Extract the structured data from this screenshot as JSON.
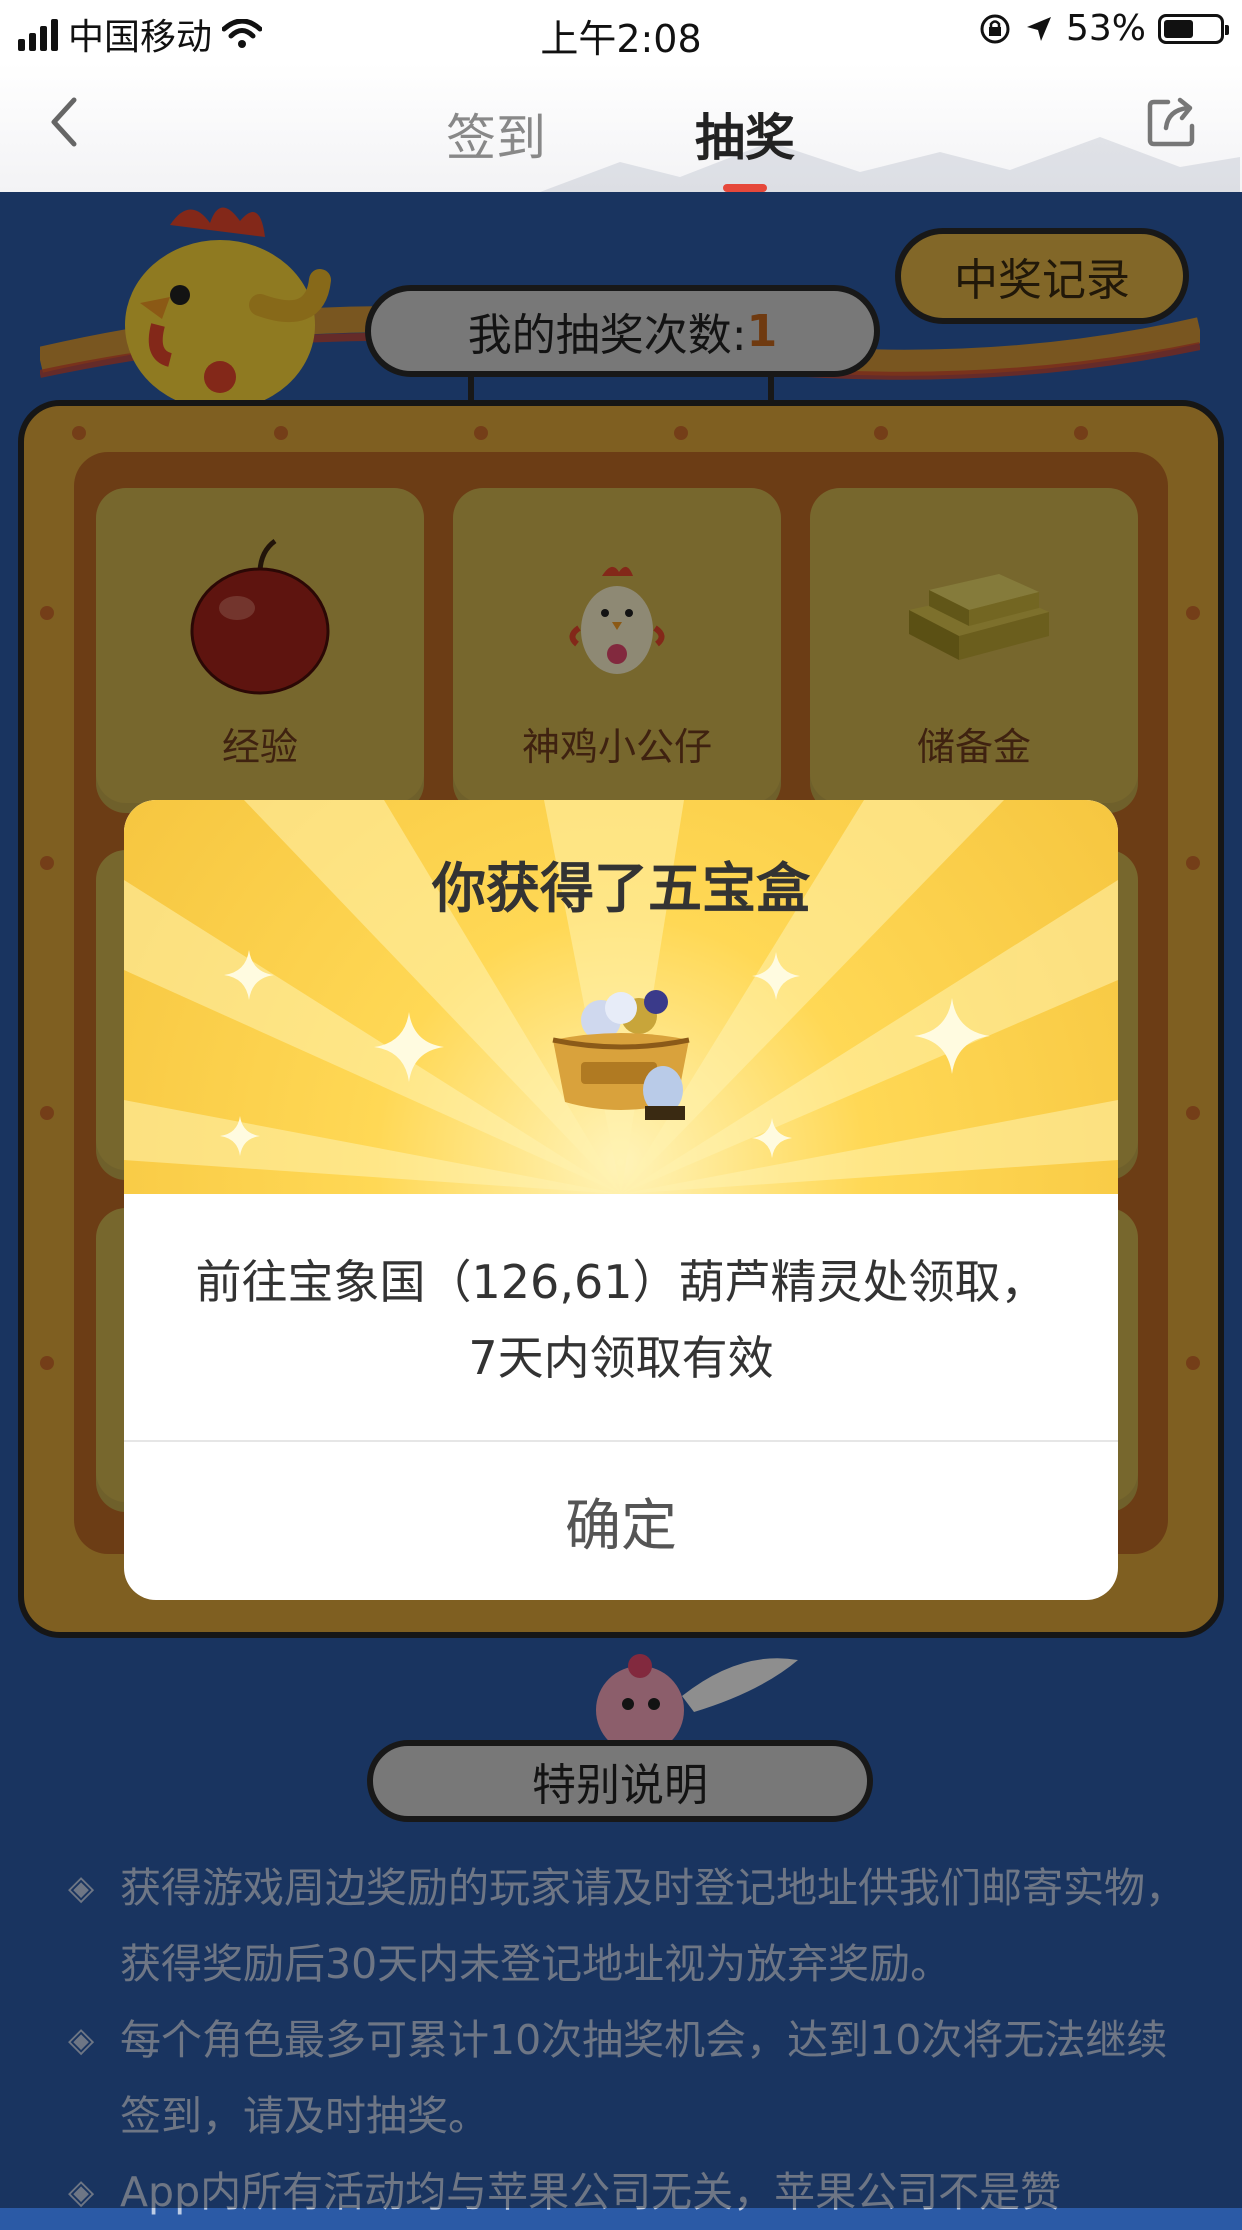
{
  "status_bar": {
    "carrier": "中国移动",
    "time": "上午2:08",
    "battery_percent": "53%",
    "battery_level": 0.53,
    "icons": [
      "signal-icon",
      "wifi-icon",
      "orientation-lock-icon",
      "location-arrow-icon",
      "battery-icon"
    ]
  },
  "nav": {
    "tabs": [
      {
        "label": "签到",
        "active": false
      },
      {
        "label": "抽奖",
        "active": true
      }
    ],
    "icons": [
      "back-chevron-icon",
      "share-icon"
    ],
    "accent_color": "#e6483b"
  },
  "lottery": {
    "record_button": "中奖记录",
    "count_label": "我的抽奖次数:",
    "count_value": "1",
    "prizes": [
      {
        "label": "经验",
        "icon": "apple-icon"
      },
      {
        "label": "神鸡小公仔",
        "icon": "chicken-doll-icon"
      },
      {
        "label": "储备金",
        "icon": "gold-bars-icon"
      }
    ]
  },
  "special": {
    "title": "特别说明",
    "bullet": "◈",
    "notes": [
      "获得游戏周边奖励的玩家请及时登记地址供我们邮寄实物，获得奖励后30天内未登记地址视为放弃奖励。",
      "每个角色最多可累计10次抽奖机会，达到10次将无法继续签到，请及时抽奖。",
      "App内所有活动均与苹果公司无关，苹果公司不是赞"
    ]
  },
  "modal": {
    "title": "你获得了五宝盒",
    "icon": "treasure-pot-icon",
    "message": "前往宝象国（126,61）葫芦精灵处领取，7天内领取有效",
    "confirm": "确定"
  },
  "colors": {
    "page_background": "#2b5aa6",
    "board_gold": "#dba43a",
    "board_inner": "#bb6a25",
    "prize_tile": "#cdb14f",
    "modal_yellow": "#f6c640"
  }
}
